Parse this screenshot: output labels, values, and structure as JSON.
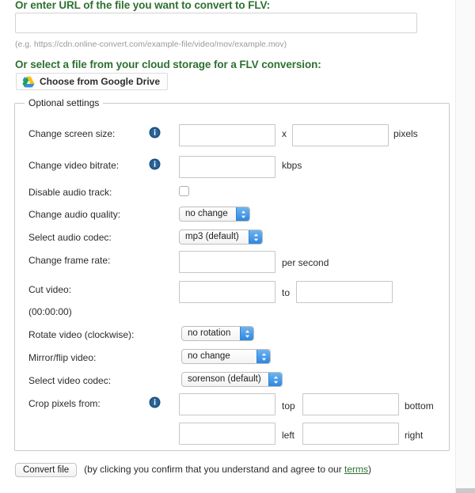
{
  "url_section": {
    "heading": "Or enter URL of the file you want to convert to FLV:",
    "input_value": "",
    "input_placeholder": "",
    "hint": "(e.g. https://cdn.online-convert.com/example-file/video/mov/example.mov)"
  },
  "cloud_section": {
    "heading": "Or select a file from your cloud storage for a FLV conversion:",
    "button_label": "Choose from Google Drive",
    "icon": "google-drive-icon"
  },
  "optional": {
    "legend": "Optional settings",
    "info_icon": "info-icon",
    "rows": {
      "screen_size": {
        "label": "Change screen size:",
        "width_value": "",
        "height_value": "",
        "separator": "x",
        "unit": "pixels"
      },
      "video_bitrate": {
        "label": "Change video bitrate:",
        "value": "",
        "unit": "kbps"
      },
      "disable_audio": {
        "label": "Disable audio track:",
        "checked": false
      },
      "audio_quality": {
        "label": "Change audio quality:",
        "selected": "no change"
      },
      "audio_codec": {
        "label": "Select audio codec:",
        "selected": "mp3 (default)"
      },
      "frame_rate": {
        "label": "Change frame rate:",
        "value": "",
        "unit": "per second"
      },
      "cut_video": {
        "label": "Cut video:",
        "from_value": "",
        "to_value": "",
        "separator": "to",
        "format_hint": "(00:00:00)"
      },
      "rotate": {
        "label": "Rotate video (clockwise):",
        "selected": "no rotation"
      },
      "mirror": {
        "label": "Mirror/flip video:",
        "selected": "no change"
      },
      "video_codec": {
        "label": "Select video codec:",
        "selected": "sorenson (default)"
      },
      "crop": {
        "label": "Crop pixels from:",
        "top_value": "",
        "top_unit": "top",
        "bottom_value": "",
        "bottom_unit": "bottom",
        "left_value": "",
        "left_unit": "left",
        "right_value": "",
        "right_unit": "right"
      }
    }
  },
  "footer": {
    "convert_label": "Convert file",
    "note_before": "(by clicking you confirm that you understand and agree to our ",
    "terms_label": "terms",
    "note_after": ")"
  },
  "colors": {
    "heading_green": "#2e7031",
    "link_green": "#2e7031",
    "select_blue": "#2f86e0",
    "info_navy": "#1d4f7c"
  }
}
